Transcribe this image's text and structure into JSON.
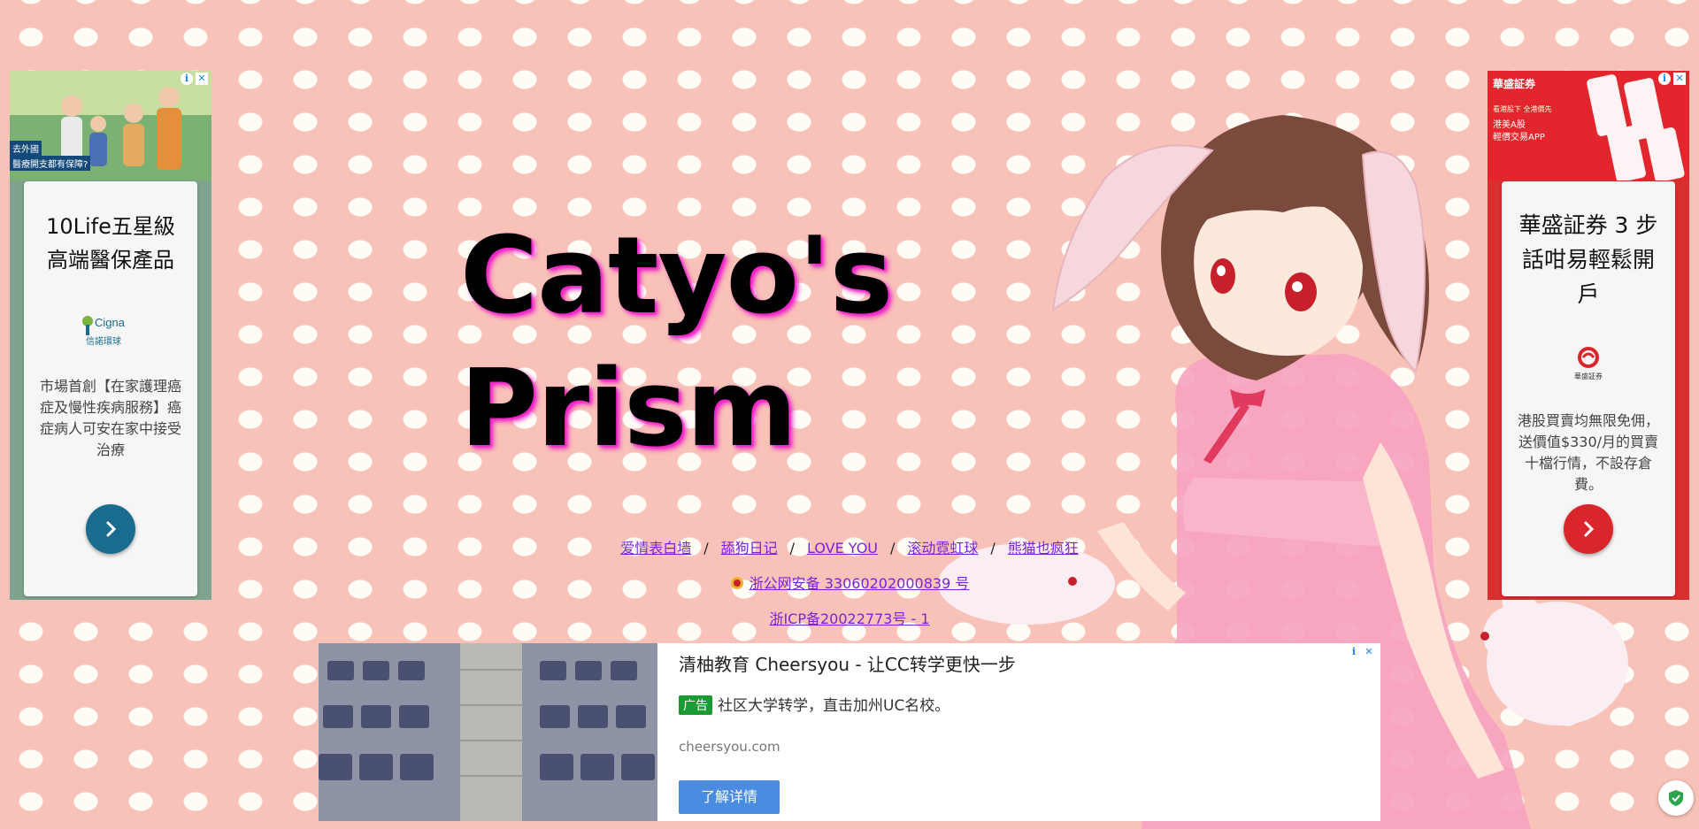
{
  "site": {
    "title": "Catyo's Prism"
  },
  "nav_links": [
    "爱情表白墙",
    "舔狗日记",
    "LOVE YOU",
    "滚动霓虹球",
    "熊猫也疯狂"
  ],
  "nav_separator": "/",
  "beian": {
    "police": "浙公网安备 33060202000839 号",
    "icp": "浙ICP备20022773号 - 1"
  },
  "left_ad": {
    "photo_caption_1": "去外國",
    "photo_caption_2": "醫療開支都有保障?",
    "headline": "10Life五星級高端醫保產品",
    "logo_text": "Cigna",
    "logo_sub": "信諾環球",
    "description": "市場首創【在家護理癌症及慢性疾病服務】癌症病人可安在家中接受治療",
    "accent": "#1a6c8e"
  },
  "right_ad": {
    "brand": "華盛証券",
    "photo_small": "看港股下 全港價先",
    "photo_headline_1": "港美A股",
    "photo_headline_2": "輕價交易APP",
    "headline": "華盛証券 3 步話咁易輕鬆開戶",
    "logo_sub": "華盛証券",
    "description": "港股買賣均無限免佣，送價值$330/月的買賣十檔行情，不設存倉費。",
    "accent": "#d9252b"
  },
  "bottom_ad": {
    "title": "清柚教育 Cheersyou - 让CC转学更快一步",
    "badge": "广告",
    "line": "社区大学转学，直击加州UC名校。",
    "url": "cheersyou.com",
    "button": "了解详情"
  },
  "ad_info_icon": "i",
  "ad_close_icon": "✕",
  "colors": {
    "background": "#f8c2b8",
    "dots": "#fffcf6",
    "link": "#7a22d8",
    "title_glow": "#f020c8"
  }
}
